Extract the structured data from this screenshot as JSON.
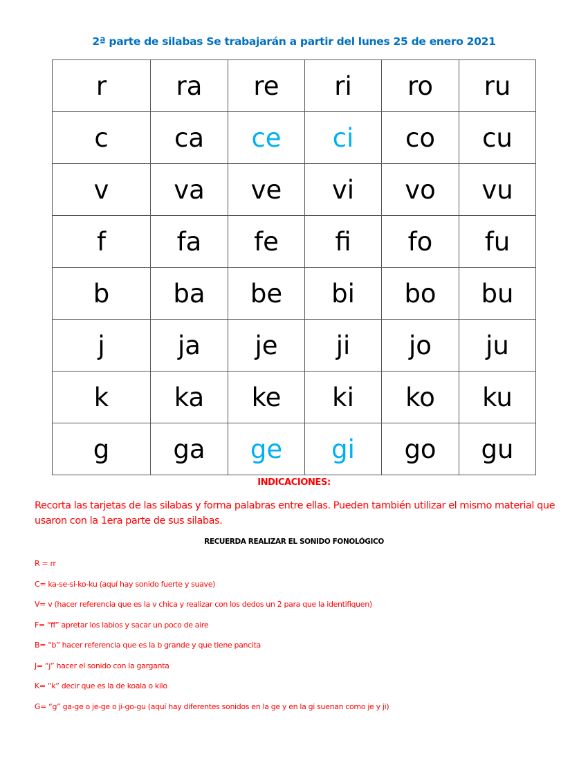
{
  "title": "2ª parte de silabas Se trabajarán a partir del lunes 25 de enero 2021",
  "colors": {
    "title": "#0070C0",
    "highlight": "#00B0F0",
    "instructions": "#FF0000",
    "text": "#000000"
  },
  "syllable_table": {
    "rows": [
      {
        "cells": [
          {
            "text": "r"
          },
          {
            "text": "ra"
          },
          {
            "text": "re"
          },
          {
            "text": "ri"
          },
          {
            "text": "ro"
          },
          {
            "text": "ru"
          }
        ]
      },
      {
        "cells": [
          {
            "text": "c"
          },
          {
            "text": "ca"
          },
          {
            "text": "ce",
            "highlight": true
          },
          {
            "text": "ci",
            "highlight": true
          },
          {
            "text": "co"
          },
          {
            "text": "cu"
          }
        ]
      },
      {
        "cells": [
          {
            "text": "v"
          },
          {
            "text": "va"
          },
          {
            "text": "ve"
          },
          {
            "text": "vi"
          },
          {
            "text": "vo"
          },
          {
            "text": "vu"
          }
        ]
      },
      {
        "cells": [
          {
            "text": "f"
          },
          {
            "text": "fa"
          },
          {
            "text": "fe"
          },
          {
            "text": "fi"
          },
          {
            "text": "fo"
          },
          {
            "text": "fu"
          }
        ]
      },
      {
        "cells": [
          {
            "text": "b"
          },
          {
            "text": "ba"
          },
          {
            "text": "be"
          },
          {
            "text": "bi"
          },
          {
            "text": "bo"
          },
          {
            "text": "bu"
          }
        ]
      },
      {
        "cells": [
          {
            "text": "j"
          },
          {
            "text": "ja"
          },
          {
            "text": "je"
          },
          {
            "text": "ji"
          },
          {
            "text": "jo"
          },
          {
            "text": "ju"
          }
        ]
      },
      {
        "cells": [
          {
            "text": "k"
          },
          {
            "text": "ka"
          },
          {
            "text": "ke"
          },
          {
            "text": "ki"
          },
          {
            "text": "ko"
          },
          {
            "text": "ku"
          }
        ]
      },
      {
        "cells": [
          {
            "text": "g"
          },
          {
            "text": "ga"
          },
          {
            "text": "ge",
            "highlight": true
          },
          {
            "text": "gi",
            "highlight": true
          },
          {
            "text": "go"
          },
          {
            "text": "gu"
          }
        ]
      }
    ]
  },
  "instructions": {
    "heading": "INDICACIONES:",
    "text": "Recorta las tarjetas de las silabas y forma palabras entre ellas. Pueden también utilizar el mismo material que usaron con la 1era parte de sus silabas.",
    "reminder": "RECUERDA REALIZAR EL SONIDO FONOLÓGICO",
    "notes": [
      "R = rr",
      "C= ka-se-si-ko-ku (aquí hay sonido fuerte y suave)",
      "V= v (hacer referencia que es la v chica y realizar con los dedos un 2 para que la identifiquen)",
      "F= “ff” apretar los labios y sacar un poco de aire",
      "B= “b” hacer referencia que es la b grande y que tiene pancita",
      "J= “j” hacer el sonido con la garganta",
      "K= “k” decir que es la de koala o kilo",
      "G= “g” ga-ge o je-ge o ji-go-gu (aquí hay diferentes sonidos en la ge y en la gi suenan como je y ji)"
    ]
  }
}
